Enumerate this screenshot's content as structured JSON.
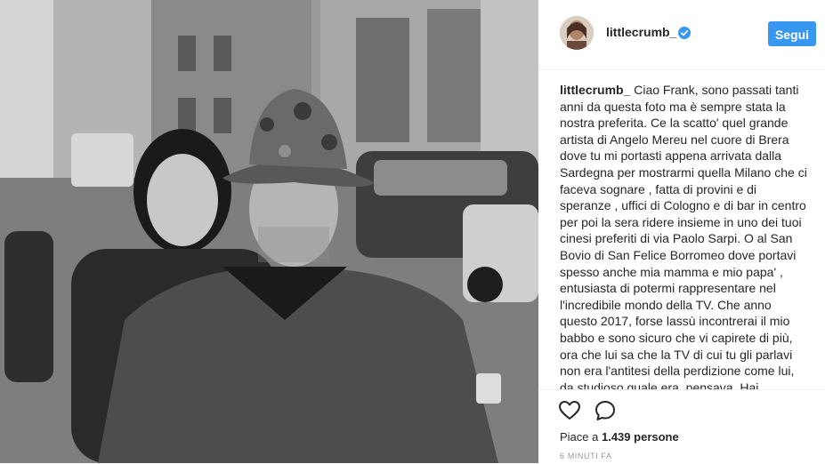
{
  "post": {
    "username": "littlecrumb_",
    "follow_label": "Segui",
    "caption_username": "littlecrumb_",
    "caption_text": " Ciao Frank, sono passati tanti anni da questa foto ma è sempre stata la nostra preferita. Ce la scatto' quel grande artista di Angelo Mereu nel cuore di Brera dove tu mi portasti appena arrivata dalla Sardegna per mostrarmi quella Milano che ci faceva sognare , fatta di provini e di speranze , uffici di Cologno e di bar in centro per poi la sera ridere insieme in uno dei tuoi cinesi preferiti di via Paolo Sarpi. O al San Bovio di San Felice Borromeo dove portavi spesso anche mia mamma e mio papa' , entusiasta di potermi rappresentare nel l'incredibile mondo della TV. Che anno questo 2017, forse lassù incontrerai il mio babbo e sono sicuro che vi capirete di più, ora che lui sa che la TV di cui tu gli parlavi non era l'antitesi della perdizione come lui, da studioso quale era, pensava. Hai",
    "likes_prefix": "Piace a ",
    "likes_count": "1.439",
    "likes_suffix": " persone",
    "timestamp": "6 MINUTI FA"
  },
  "icons": {
    "verified": "verified-badge-icon",
    "like": "heart-icon",
    "comment": "comment-icon"
  },
  "colors": {
    "follow_button": "#3897f0",
    "verified": "#3897f0",
    "text": "#262626",
    "muted": "#999999"
  }
}
